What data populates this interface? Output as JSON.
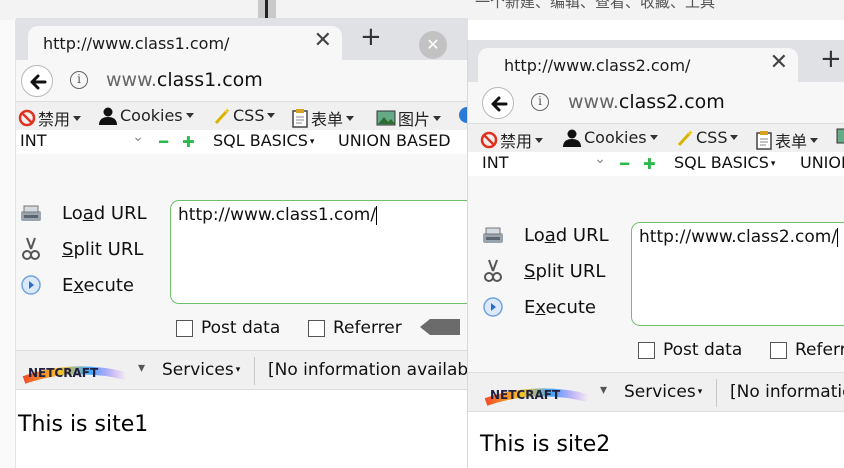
{
  "windows": [
    {
      "tab_title": "http://www.class1.com/",
      "tab_close": "✕",
      "new_tab": "+",
      "address": {
        "prefix": "www.",
        "domain": "class1.com"
      },
      "bookmarks": {
        "disable": "禁用",
        "cookies": "Cookies",
        "css": "CSS",
        "forms": "表单",
        "images": "图片"
      },
      "hackbar": {
        "select_value": "INT",
        "sql_basics": "SQL BASICS",
        "union_based": "UNION BASED"
      },
      "actions": {
        "load_pre": "Lo",
        "load_u": "a",
        "load_post": "d URL",
        "split_u": "S",
        "split_post": "plit URL",
        "exec_pre": "E",
        "exec_u": "x",
        "exec_post": "ecute"
      },
      "url_field": "http://www.class1.com/",
      "checkboxes": {
        "post_data": "Post data",
        "referrer": "Referrer"
      },
      "netcraft": {
        "services": "Services",
        "info": "[No information available]"
      },
      "page_content": "This is site1"
    },
    {
      "tab_title": "http://www.class2.com/",
      "tab_close": "✕",
      "new_tab": "+",
      "address": {
        "prefix": "www.",
        "domain": "class2.com"
      },
      "bookmarks": {
        "disable": "禁用",
        "cookies": "Cookies",
        "css": "CSS",
        "forms": "表单"
      },
      "hackbar": {
        "select_value": "INT",
        "sql_basics": "SQL BASICS",
        "union_based": "UNION BASED"
      },
      "actions": {
        "load_pre": "Lo",
        "load_u": "a",
        "load_post": "d URL",
        "split_u": "S",
        "split_post": "plit URL",
        "exec_pre": "E",
        "exec_u": "x",
        "exec_post": "ecute"
      },
      "url_field": "http://www.class2.com/",
      "checkboxes": {
        "post_data": "Post data",
        "referrer": "Referrer"
      },
      "netcraft": {
        "services": "Services",
        "info": "[No information available]"
      },
      "page_content": "This is site2"
    }
  ],
  "background_text": "一个新建、编辑、查看、收藏、工具",
  "colors": {
    "url_box_border": "#6fbf6f",
    "hackbar_plus": "#2cb84a",
    "disable_icon": "#e0301e"
  }
}
